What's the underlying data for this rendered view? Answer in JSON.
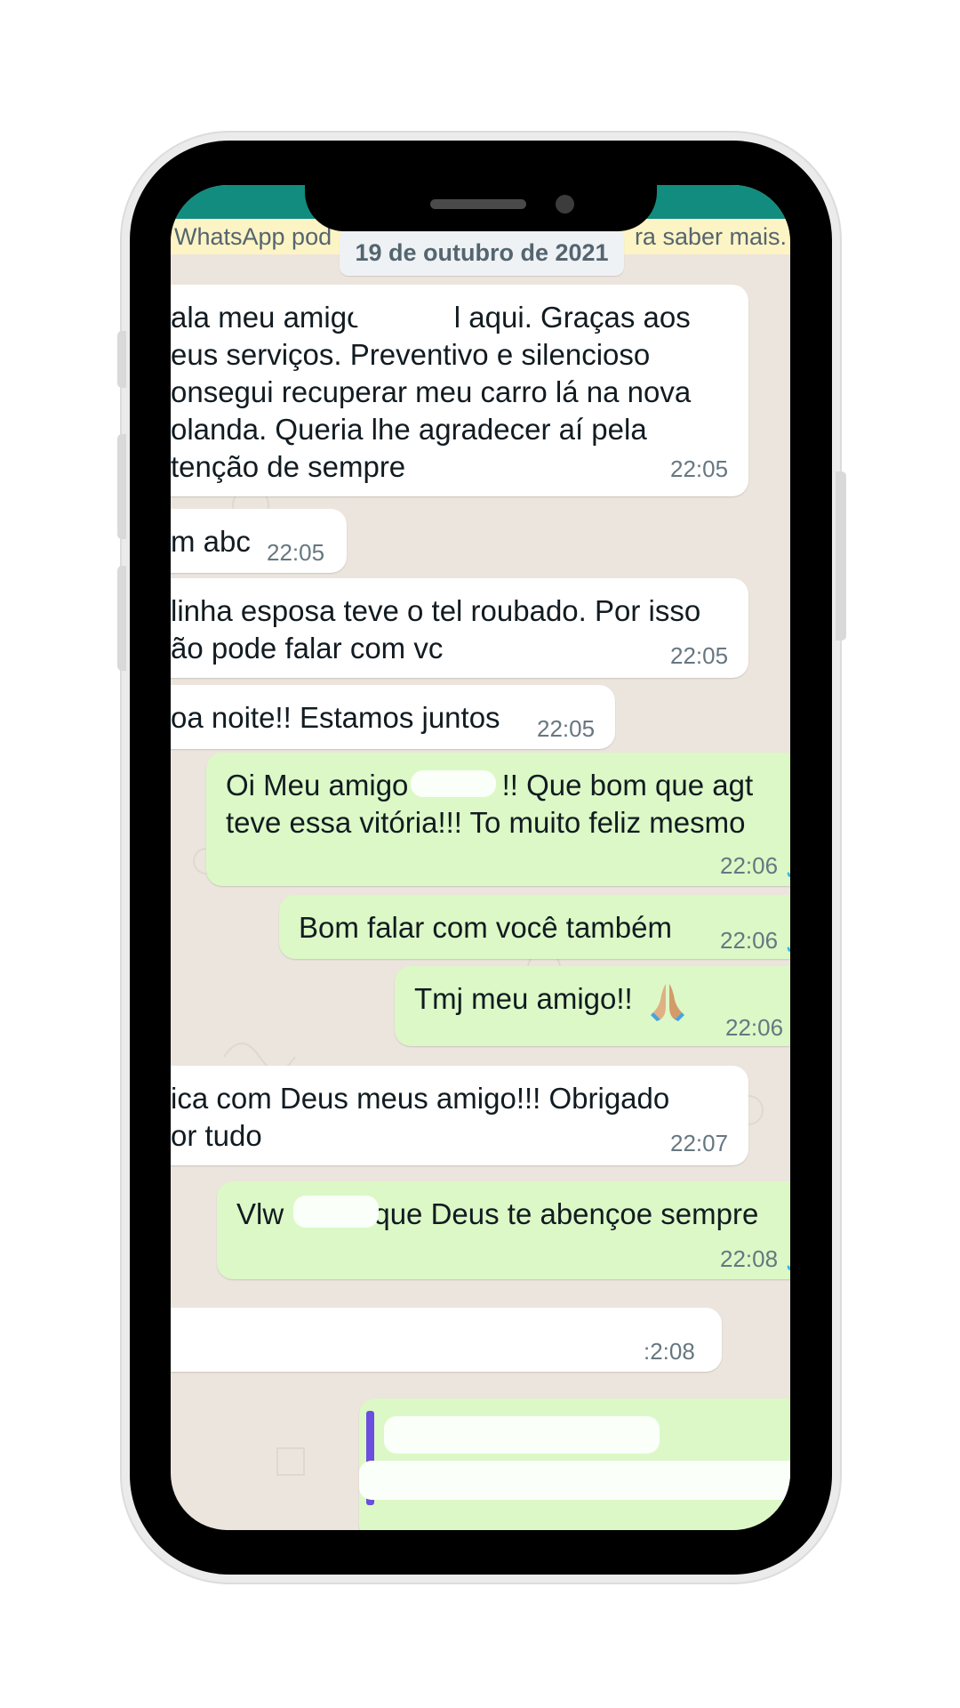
{
  "chat": {
    "banner_left": "WhatsApp pod",
    "banner_right": "ra saber mais.",
    "date": "19 de outubro de 2021"
  },
  "messages": [
    {
      "direction": "in",
      "lines": [
        "ala meu amigo. ",
        "eus serviços. Preventivo e silencioso",
        "onsegui recuperar meu carro lá na nova",
        "olanda. Queria lhe agradecer aí pela",
        "tenção de sempre"
      ],
      "line1_tail": "l aqui. Graças aos",
      "time": "22:05"
    },
    {
      "direction": "in",
      "lines": [
        "m abc"
      ],
      "time": "22:05"
    },
    {
      "direction": "in",
      "lines": [
        "linha esposa teve o tel roubado. Por isso",
        "ão pode falar com vc"
      ],
      "time": "22:05"
    },
    {
      "direction": "in",
      "lines": [
        "oa noite!! Estamos juntos"
      ],
      "time": "22:05"
    },
    {
      "direction": "out",
      "lines": [
        "Oi Meu amigo ",
        "teve essa vitória!!! To muito feliz mesmo"
      ],
      "line1_tail": "!! Que bom que agt",
      "time": "22:06"
    },
    {
      "direction": "out",
      "lines": [
        "Bom falar com você também"
      ],
      "time": "22:06"
    },
    {
      "direction": "out",
      "lines": [
        "Tmj meu amigo!!"
      ],
      "time": "22:06",
      "emoji": "folded-hands"
    },
    {
      "direction": "in",
      "lines": [
        "ica com Deus meus amigo!!! Obrigado",
        "or tudo"
      ],
      "time": "22:07"
    },
    {
      "direction": "out",
      "lines": [
        "Vlw "
      ],
      "line1_tail": "que Deus te abençoe sempre",
      "time": "22:08"
    },
    {
      "direction": "in",
      "lines": [],
      "time": ":2:08"
    },
    {
      "direction": "out",
      "lines": [],
      "quoted": true
    }
  ],
  "colors": {
    "header": "#128c7e",
    "chat_background": "#ece5dd",
    "incoming_bubble": "#ffffff",
    "outgoing_bubble": "#dcf8c6",
    "read_ticks": "#34b7f1"
  }
}
